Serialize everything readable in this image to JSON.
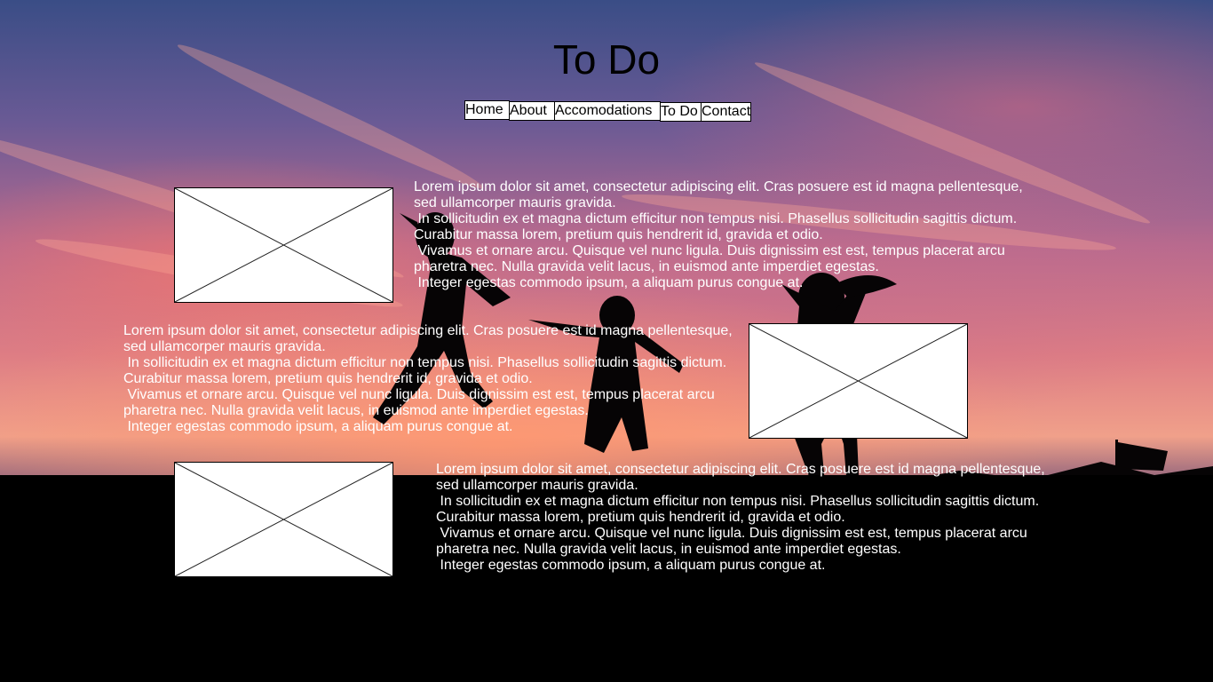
{
  "page": {
    "title": "To Do"
  },
  "nav": {
    "items": [
      {
        "label": "Home"
      },
      {
        "label": "About"
      },
      {
        "label": "Accomodations"
      },
      {
        "label": "To Do"
      },
      {
        "label": "Contact"
      }
    ]
  },
  "sections": [
    {
      "lines": [
        "Lorem ipsum dolor sit amet, consectetur adipiscing elit. Cras posuere est id magna pellentesque,",
        "sed ullamcorper mauris gravida.",
        " In sollicitudin ex et magna dictum efficitur non tempus nisi. Phasellus sollicitudin sagittis dictum.",
        "Curabitur massa lorem, pretium quis hendrerit id, gravida et odio.",
        " Vivamus et ornare arcu. Quisque vel nunc ligula. Duis dignissim est est, tempus placerat arcu",
        "pharetra nec. Nulla gravida velit lacus, in euismod ante imperdiet egestas.",
        " Integer egestas commodo ipsum, a aliquam purus congue at."
      ]
    },
    {
      "lines": [
        "Lorem ipsum dolor sit amet, consectetur adipiscing elit. Cras posuere est id magna pellentesque,",
        "sed ullamcorper mauris gravida.",
        " In sollicitudin ex et magna dictum efficitur non tempus nisi. Phasellus sollicitudin sagittis dictum.",
        "Curabitur massa lorem, pretium quis hendrerit id, gravida et odio.",
        " Vivamus et ornare arcu. Quisque vel nunc ligula. Duis dignissim est est, tempus placerat arcu",
        "pharetra nec. Nulla gravida velit lacus, in euismod ante imperdiet egestas.",
        " Integer egestas commodo ipsum, a aliquam purus congue at."
      ]
    },
    {
      "lines": [
        "Lorem ipsum dolor sit amet, consectetur adipiscing elit. Cras posuere est id magna pellentesque,",
        "sed ullamcorper mauris gravida.",
        " In sollicitudin ex et magna dictum efficitur non tempus nisi. Phasellus sollicitudin sagittis dictum.",
        "Curabitur massa lorem, pretium quis hendrerit id, gravida et odio.",
        " Vivamus et ornare arcu. Quisque vel nunc ligula. Duis dignissim est est, tempus placerat arcu",
        "pharetra nec. Nulla gravida velit lacus, in euismod ante imperdiet egestas.",
        " Integer egestas commodo ipsum, a aliquam purus congue at."
      ]
    }
  ],
  "colors": {
    "text": "#ffffff",
    "title": "#000000",
    "nav_bg": "#ffffff"
  }
}
